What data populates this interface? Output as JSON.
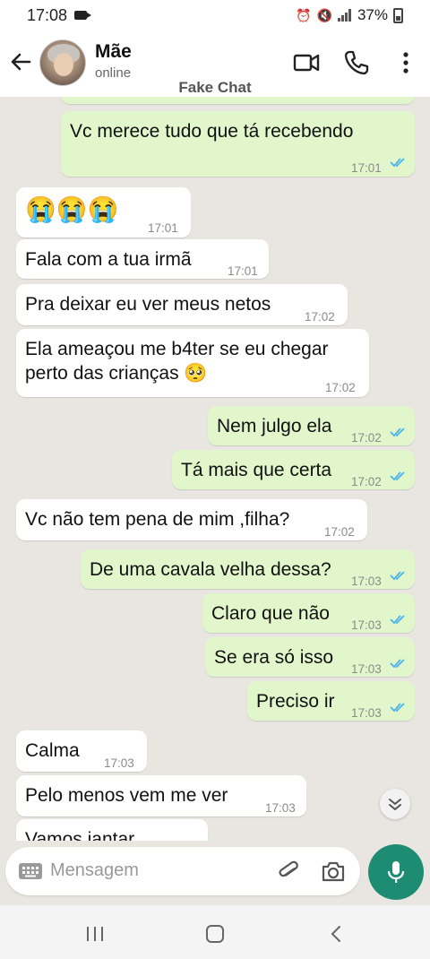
{
  "status_bar": {
    "time": "17:08",
    "battery": "37%"
  },
  "header": {
    "name": "Mãe",
    "status": "online",
    "watermark": "Fake Chat"
  },
  "messages": [
    {
      "dir": "out",
      "text": "Vc merece tudo que tá recebendo",
      "time": "17:01",
      "read": true
    },
    {
      "dir": "in",
      "text": "😭😭😭",
      "time": "17:01"
    },
    {
      "dir": "in",
      "text": "Fala com a tua irmã",
      "time": "17:01"
    },
    {
      "dir": "in",
      "text": "Pra deixar eu ver meus netos",
      "time": "17:02"
    },
    {
      "dir": "in",
      "text_line1": "Ela ameaçou me b4ter se eu chegar",
      "text_line2": "perto das crianças 🥺",
      "time": "17:02"
    },
    {
      "dir": "out",
      "text": "Nem julgo ela",
      "time": "17:02",
      "read": true
    },
    {
      "dir": "out",
      "text": "Tá mais que certa",
      "time": "17:02",
      "read": true
    },
    {
      "dir": "in",
      "text": "Vc não tem pena de mim ,filha?",
      "time": "17:02"
    },
    {
      "dir": "out",
      "text": "De uma cavala velha dessa?",
      "time": "17:03",
      "read": true
    },
    {
      "dir": "out",
      "text": "Claro que não",
      "time": "17:03",
      "read": true
    },
    {
      "dir": "out",
      "text": "Se era só isso",
      "time": "17:03",
      "read": true
    },
    {
      "dir": "out",
      "text": "Preciso ir",
      "time": "17:03",
      "read": true
    },
    {
      "dir": "in",
      "text": "Calma",
      "time": "17:03"
    },
    {
      "dir": "in",
      "text": "Pelo menos vem me ver",
      "time": "17:03"
    },
    {
      "dir": "in",
      "text": "Vamos jantar",
      "time": ""
    }
  ],
  "composer": {
    "placeholder": "Mensagem"
  },
  "colors": {
    "accent": "#1e8c72",
    "outgoing_bubble": "#e1f7cb",
    "read_ticks": "#4fb3e8"
  }
}
